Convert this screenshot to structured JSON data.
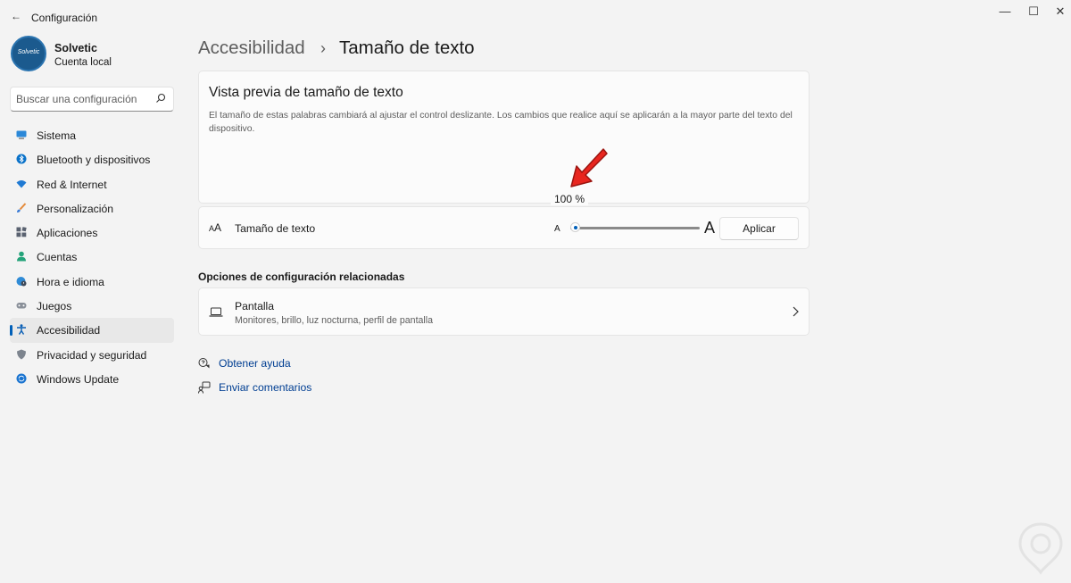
{
  "window": {
    "title": "Configuración",
    "back_glyph": "←",
    "minimize_glyph": "—",
    "maximize_glyph": "☐",
    "close_glyph": "✕"
  },
  "account": {
    "name": "Solvetic",
    "type": "Cuenta local",
    "avatar_text": "Solvetic"
  },
  "search": {
    "placeholder": "Buscar una configuración",
    "icon": "search-icon"
  },
  "nav": {
    "items": [
      {
        "label": "Sistema",
        "icon": "monitor-icon",
        "active": false
      },
      {
        "label": "Bluetooth y dispositivos",
        "icon": "bluetooth-icon",
        "active": false
      },
      {
        "label": "Red & Internet",
        "icon": "wifi-icon",
        "active": false
      },
      {
        "label": "Personalización",
        "icon": "brush-icon",
        "active": false
      },
      {
        "label": "Aplicaciones",
        "icon": "apps-icon",
        "active": false
      },
      {
        "label": "Cuentas",
        "icon": "person-icon",
        "active": false
      },
      {
        "label": "Hora e idioma",
        "icon": "globe-clock-icon",
        "active": false
      },
      {
        "label": "Juegos",
        "icon": "gamepad-icon",
        "active": false
      },
      {
        "label": "Accesibilidad",
        "icon": "accessibility-icon",
        "active": true
      },
      {
        "label": "Privacidad y seguridad",
        "icon": "shield-icon",
        "active": false
      },
      {
        "label": "Windows Update",
        "icon": "refresh-icon",
        "active": false
      }
    ]
  },
  "breadcrumb": {
    "parent": "Accesibilidad",
    "separator": "›",
    "current": "Tamaño de texto"
  },
  "preview": {
    "title": "Vista previa de tamaño de texto",
    "description": "El tamaño de estas palabras cambiará al ajustar el control deslizante. Los cambios que realice aquí se aplicarán a la mayor parte del texto del dispositivo.",
    "percent_label": "100 %"
  },
  "text_size": {
    "label": "Tamaño de texto",
    "icon_text_small": "A",
    "icon_text_large": "A",
    "slider_min_label": "A",
    "slider_max_label": "A",
    "slider_value_fraction": 0,
    "apply_label": "Aplicar"
  },
  "related": {
    "title": "Opciones de configuración relacionadas",
    "display": {
      "title": "Pantalla",
      "subtitle": "Monitores, brillo, luz nocturna, perfil de pantalla"
    }
  },
  "links": {
    "help": "Obtener ayuda",
    "feedback": "Enviar comentarios"
  },
  "colors": {
    "accent": "#005fb8",
    "link": "#003e92",
    "arrow": "#e8261f"
  }
}
